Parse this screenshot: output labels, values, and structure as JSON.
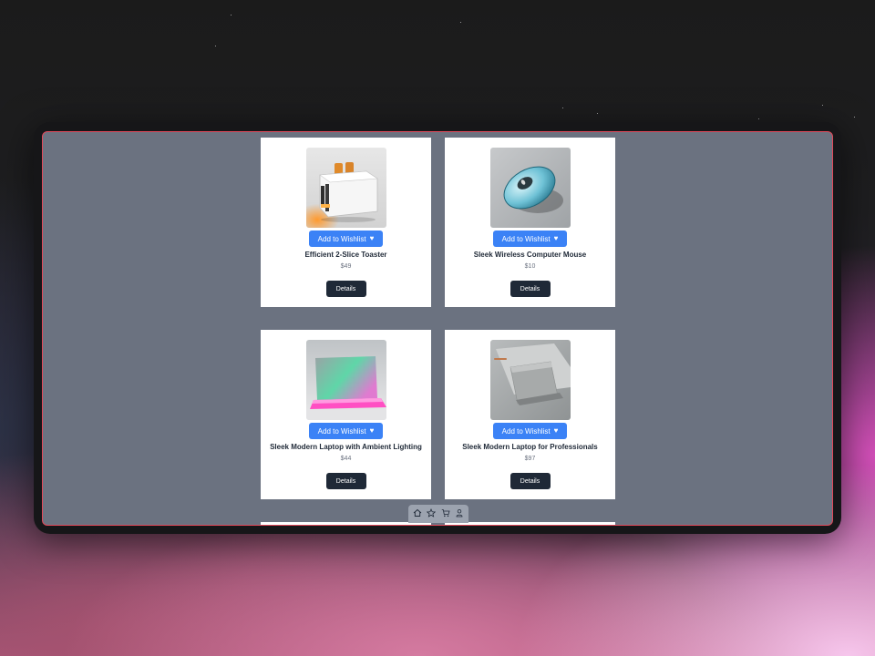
{
  "products": [
    {
      "title": "Efficient 2-Slice Toaster",
      "price": "$49",
      "wishlist_label": "Add to Wishlist",
      "details_label": "Details",
      "image": "toaster"
    },
    {
      "title": "Sleek Wireless Computer Mouse",
      "price": "$10",
      "wishlist_label": "Add to Wishlist",
      "details_label": "Details",
      "image": "mouse"
    },
    {
      "title": "Sleek Modern Laptop with Ambient Lighting",
      "price": "$44",
      "wishlist_label": "Add to Wishlist",
      "details_label": "Details",
      "image": "laptop-ambient"
    },
    {
      "title": "Sleek Modern Laptop for Professionals",
      "price": "$97",
      "wishlist_label": "Add to Wishlist",
      "details_label": "Details",
      "image": "laptop-pro"
    }
  ],
  "icons": {
    "wishlist": "heart-icon",
    "nav": [
      "home-icon",
      "star-icon",
      "cart-icon",
      "user-icon"
    ]
  },
  "colors": {
    "screen_background": "#6b7280",
    "card_background": "#ffffff",
    "wishlist_button": "#3b82f6",
    "details_button": "#1f2937",
    "screen_border": "#e1495a",
    "bottom_nav": "#9ca3af"
  }
}
